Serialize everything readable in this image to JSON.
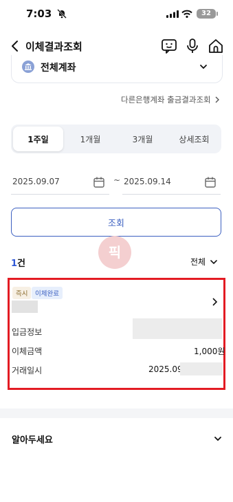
{
  "status_bar": {
    "time": "7:03",
    "battery": "32"
  },
  "header": {
    "title": "이체결과조회"
  },
  "account_select": {
    "label": "전체계좌"
  },
  "other_bank_link": {
    "label": "다른은행계좌 출금결과조회"
  },
  "period_tabs": [
    {
      "label": "1주일",
      "active": true
    },
    {
      "label": "1개월",
      "active": false
    },
    {
      "label": "3개월",
      "active": false
    },
    {
      "label": "상세조회",
      "active": false
    }
  ],
  "date_range": {
    "start": "2025.09.07",
    "separator": "~",
    "end": "2025.09.14"
  },
  "search_button": {
    "label": "조회"
  },
  "watermark": {
    "text": "픽"
  },
  "results": {
    "count_number": "1",
    "count_suffix": "건",
    "filter_label": "전체"
  },
  "transaction": {
    "tags": [
      "즉시",
      "이체완료"
    ],
    "rows": [
      {
        "label": "입금정보",
        "value": ""
      },
      {
        "label": "이체금액",
        "value": "1,000원"
      },
      {
        "label": "거래일시",
        "value": "2025.09"
      }
    ]
  },
  "notice": {
    "title": "알아두세요"
  },
  "colors": {
    "accent": "#2f58d6",
    "button_border": "#3b5fc0",
    "highlight_frame": "#e31b23"
  }
}
